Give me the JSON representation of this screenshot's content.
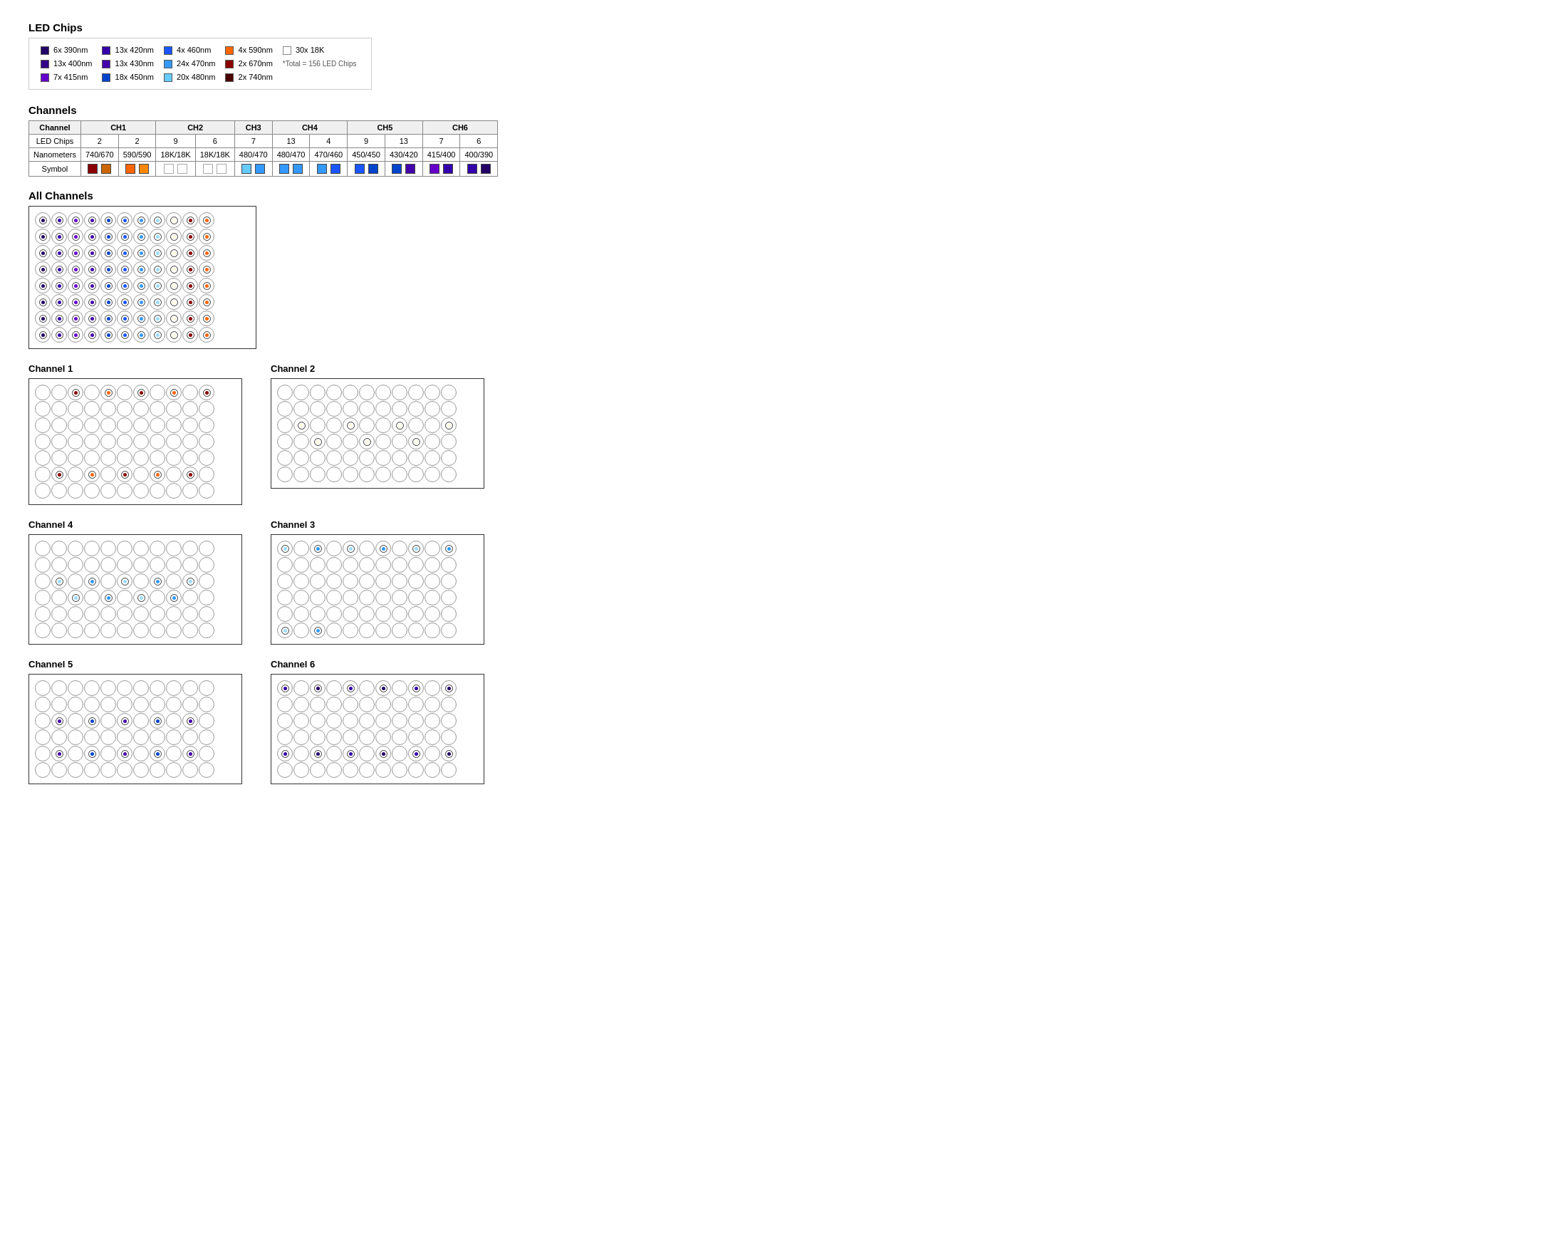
{
  "page": {
    "led_chips_title": "LED Chips",
    "channels_title": "Channels",
    "all_channels_title": "All Channels",
    "channel1_title": "Channel 1",
    "channel2_title": "Channel 2",
    "channel3_title": "Channel 3",
    "channel4_title": "Channel 4",
    "channel5_title": "Channel 5",
    "channel6_title": "Channel 6"
  },
  "led_legend": [
    {
      "label": "6x 390nm",
      "color": "#220066"
    },
    {
      "label": "13x 420nm",
      "color": "#3300aa"
    },
    {
      "label": "4x 460nm",
      "color": "#1a56ff"
    },
    {
      "label": "4x 590nm",
      "color": "#FF6600"
    },
    {
      "label": "30x 18K",
      "color": "#ffffff"
    },
    {
      "label": "13x 400nm",
      "color": "#330088"
    },
    {
      "label": "13x 430nm",
      "color": "#4400aa"
    },
    {
      "label": "24x 470nm",
      "color": "#3399ff"
    },
    {
      "label": "2x 670nm",
      "color": "#8B0000"
    },
    {
      "label": "7x 415nm",
      "color": "#6600cc"
    },
    {
      "label": "18x 450nm",
      "color": "#0044cc"
    },
    {
      "label": "20x 480nm",
      "color": "#66ccff"
    },
    {
      "label": "2x 740nm",
      "color": "#4a0000"
    },
    {
      "label": "*Total = 156 LED Chips",
      "color": null
    }
  ],
  "channels_table": {
    "headers": [
      "Channel",
      "CH1",
      "",
      "CH2",
      "",
      "CH3",
      "CH4",
      "",
      "CH5",
      "",
      "CH6",
      "",
      ""
    ],
    "led_chips": [
      "LED Chips",
      "2",
      "2",
      "9",
      "6",
      "7",
      "13",
      "4",
      "9",
      "13",
      "7",
      "6"
    ],
    "nanometers": [
      "Nanometers",
      "740/670",
      "590/590",
      "18K/18K",
      "18K/18K",
      "480/470",
      "480/470",
      "470/460",
      "450/450",
      "430/420",
      "415/400",
      "400/390"
    ],
    "symbol_colors": [
      [
        "#8B0000",
        "#CC6600"
      ],
      [
        "#FF6600",
        "#FF6600"
      ],
      [
        "#ffffff",
        "#ffffff"
      ],
      [
        "#ffffff",
        "#ffffff"
      ],
      [
        "#66ccff",
        "#3399ff"
      ],
      [
        "#3399ff",
        "#3399ff"
      ],
      [
        "#3399ff",
        "#1a56ff"
      ],
      [
        "#1a56ff",
        "#0044cc"
      ],
      [
        "#0044cc",
        "#4400aa"
      ],
      [
        "#6600cc",
        "#3300aa"
      ],
      [
        "#3300aa",
        "#220066"
      ]
    ]
  }
}
